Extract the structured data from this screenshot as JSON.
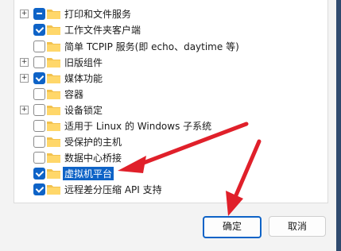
{
  "features": [
    {
      "label": "打印和文件服务",
      "state": "partial",
      "expandable": true
    },
    {
      "label": "工作文件夹客户端",
      "state": "checked",
      "expandable": false
    },
    {
      "label": "简单 TCPIP 服务(即 echo、daytime 等)",
      "state": "unchecked",
      "expandable": false
    },
    {
      "label": "旧版组件",
      "state": "unchecked",
      "expandable": true
    },
    {
      "label": "媒体功能",
      "state": "checked",
      "expandable": true
    },
    {
      "label": "容器",
      "state": "unchecked",
      "expandable": false
    },
    {
      "label": "设备锁定",
      "state": "unchecked",
      "expandable": true
    },
    {
      "label": "适用于 Linux 的 Windows 子系统",
      "state": "unchecked",
      "expandable": false
    },
    {
      "label": "受保护的主机",
      "state": "unchecked",
      "expandable": false
    },
    {
      "label": "数据中心桥接",
      "state": "unchecked",
      "expandable": false
    },
    {
      "label": "虚拟机平台",
      "state": "checked",
      "expandable": false,
      "selected": true
    },
    {
      "label": "远程差分压缩 API 支持",
      "state": "checked",
      "expandable": false
    }
  ],
  "buttons": {
    "ok_label": "确定",
    "cancel_label": "取消"
  },
  "expander_glyph": "+",
  "accent_color": "#0e63c7",
  "annotation_color": "#e0202a"
}
